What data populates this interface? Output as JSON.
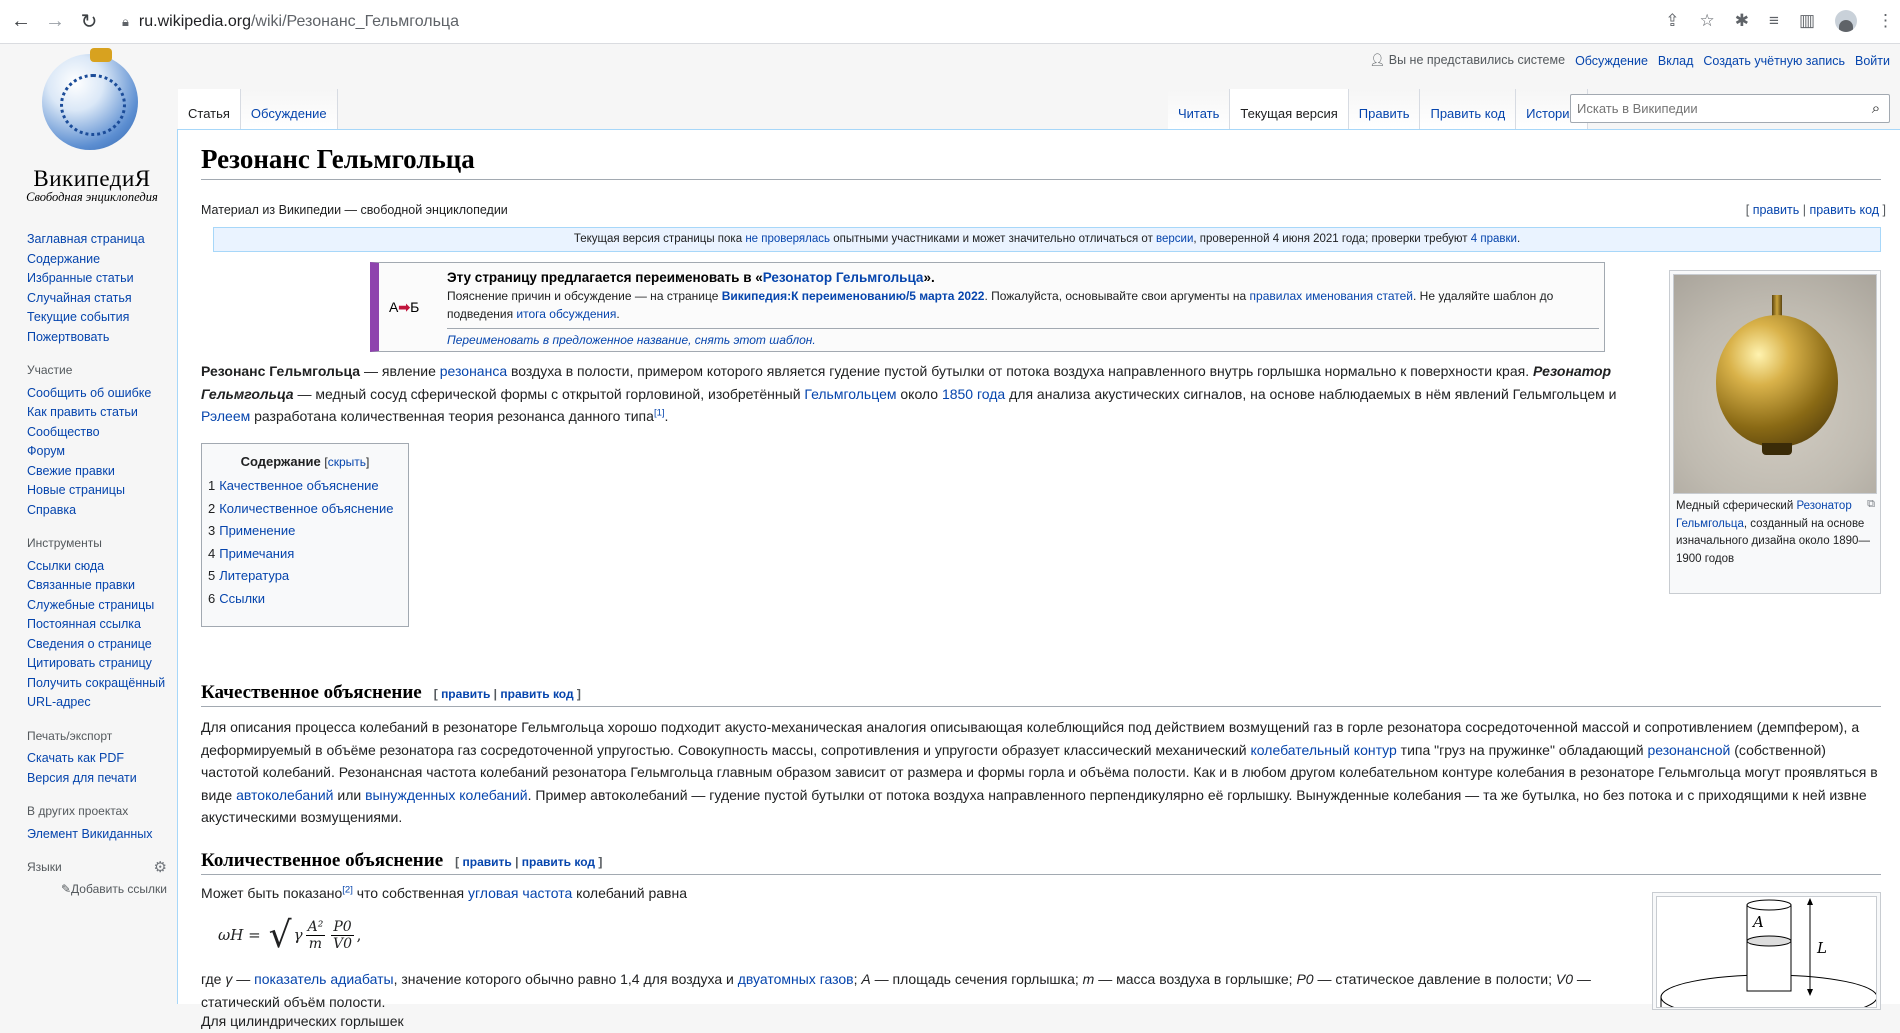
{
  "browser": {
    "url_host": "ru.wikipedia.org",
    "url_path": "/wiki/Резонанс_Гельмгольца"
  },
  "logo": {
    "title": "ВикипедиЯ",
    "subtitle": "Свободная энциклопедия"
  },
  "personal": {
    "anon": "Вы не представились системе",
    "links": [
      "Обсуждение",
      "Вклад",
      "Создать учётную запись",
      "Войти"
    ]
  },
  "sidebar": {
    "nav": [
      "Заглавная страница",
      "Содержание",
      "Избранные статьи",
      "Случайная статья",
      "Текущие события",
      "Пожертвовать"
    ],
    "participation_head": "Участие",
    "participation": [
      "Сообщить об ошибке",
      "Как править статьи",
      "Сообщество",
      "Форум",
      "Свежие правки",
      "Новые страницы",
      "Справка"
    ],
    "tools_head": "Инструменты",
    "tools": [
      "Ссылки сюда",
      "Связанные правки",
      "Служебные страницы",
      "Постоянная ссылка",
      "Сведения о странице",
      "Цитировать страницу",
      "Получить сокращённый URL-адрес"
    ],
    "print_head": "Печать/экспорт",
    "print": [
      "Скачать как PDF",
      "Версия для печати"
    ],
    "other_head": "В других проектах",
    "other": [
      "Элемент Викиданных"
    ],
    "lang_head": "Языки",
    "add_links": "Добавить ссылки"
  },
  "tabs": {
    "left": [
      "Статья",
      "Обсуждение"
    ],
    "right": [
      "Читать",
      "Текущая версия",
      "Править",
      "Править код",
      "История"
    ]
  },
  "search": {
    "placeholder": "Искать в Википедии"
  },
  "article": {
    "title": "Резонанс Гельмгольца",
    "subtitle": "Материал из Википедии — свободной энциклопедии",
    "edit_top": [
      "править",
      "править код"
    ],
    "flagged": {
      "t1": "Текущая версия страницы пока ",
      "l1": "не проверялась",
      "t2": " опытными участниками и может значительно отличаться от ",
      "l2": "версии",
      "t3": ", проверенной 4 июня 2021 года; проверки требуют ",
      "l3": "4 правки",
      "t4": "."
    },
    "rename": {
      "icon_a": "А",
      "icon_b": "Б",
      "heading_pre": "Эту страницу предлагается переименовать в «",
      "heading_link": "Резонатор Гельмгольца",
      "heading_post": "».",
      "t1": "Пояснение причин и обсуждение — на странице ",
      "l1": "Википедия:К переименованию/5 марта 2022",
      "t2": ". Пожалуйста, основывайте свои аргументы на ",
      "l2": "правилах именования статей",
      "t3": ". Не удаляйте шаблон до подведения ",
      "l3": "итога обсуждения",
      "t4": ".",
      "foot": "Переименовать в предложенное название, снять этот шаблон."
    },
    "intro": {
      "b1": "Резонанс Гельмгольца",
      "t1": " — явление ",
      "l1": "резонанса",
      "t2": " воздуха в полости, примером которого является гудение пустой бутылки от потока воздуха направленного внутрь горлышка нормально к поверхности края. ",
      "b2": "Резонатор Гельмгольца",
      "t3": " — медный сосуд сферической формы с открытой горловиной, изобретённый ",
      "l2": "Гельмгольцем",
      "t4": " около ",
      "l3": "1850 года",
      "t5": " для анализа акустических сигналов, на основе наблюдаемых в нём явлений Гельмгольцем и ",
      "l4": "Рэлеем",
      "t6": " разработана количественная теория резонанса данного типа",
      "ref": "[1]",
      "t7": "."
    },
    "toc": {
      "title": "Содержание",
      "hide": "скрыть",
      "items": [
        {
          "num": "1",
          "label": "Качественное объяснение"
        },
        {
          "num": "2",
          "label": "Количественное объяснение"
        },
        {
          "num": "3",
          "label": "Применение"
        },
        {
          "num": "4",
          "label": "Примечания"
        },
        {
          "num": "5",
          "label": "Литература"
        },
        {
          "num": "6",
          "label": "Ссылки"
        }
      ]
    },
    "thumb": {
      "c1": "Медный сферический ",
      "link": "Резонатор Гельмгольца",
      "c2": ", созданный на основе изначального дизайна около 1890—1900 годов"
    },
    "section1": {
      "title": "Качественное объяснение",
      "edit": "править",
      "edit_code": "править код",
      "t1": "Для описания процесса колебаний в резонаторе Гельмгольца хорошо подходит акусто-механическая аналогия описывающая колеблющийся под действием возмущений газ в горле резонатора сосредоточенной массой и сопротивлением (демпфером), а деформируемый в объёме резонатора газ сосредоточенной упругостью. Совокупность массы, сопротивления и упругости образует классический механический ",
      "l1": "колебательный контур",
      "t2": " типа \"груз на пружинке\" обладающий ",
      "l2": "резонансной",
      "t3": " (собственной) частотой колебаний. Резонансная частота колебаний резонатора Гельмгольца главным образом зависит от размера и формы горла и объёма полости. Как и в любом другом колебательном контуре колебания в резонаторе Гельмгольца могут проявляться в виде ",
      "l3": "автоколебаний",
      "t4": " или ",
      "l4": "вынужденных колебаний",
      "t5": ". Пример автоколебаний — гудение пустой бутылки от потока воздуха направленного перпендикулярно её горлышку. Вынужденные колебания — та же бутылка, но без потока и с приходящими к ней извне акустическими возмущениями."
    },
    "section2": {
      "title": "Количественное объяснение",
      "edit": "править",
      "edit_code": "править код",
      "t1": "Может быть показано",
      "ref": "[2]",
      "t2": " что собственная ",
      "l1": "угловая частота",
      "t3": " колебаний равна",
      "formula": {
        "lhs": "ωH =",
        "gamma": "γ",
        "f1_num": "A²",
        "f1_den": "m",
        "f2_num": "P0",
        "f2_den": "V0",
        "tail": ","
      },
      "w1": "где ",
      "w_gamma": "γ",
      "w2": " — ",
      "wl1": "показатель адиабаты",
      "w3": ", значение которого обычно равно 1,4 для воздуха и ",
      "wl2": "двуатомных газов",
      "w4": "; ",
      "w_A": "A",
      "w5": " — площадь сечения горлышка; ",
      "w_m": "m",
      "w6": " — масса воздуха в горлышке; ",
      "w_P": "P0",
      "w7": " — статическое давление в полости; ",
      "w_V": "V0",
      "w8": " — статический объём полости.",
      "cyl": "Для цилиндрических горлышек",
      "diag_A": "A",
      "diag_L": "L"
    }
  }
}
